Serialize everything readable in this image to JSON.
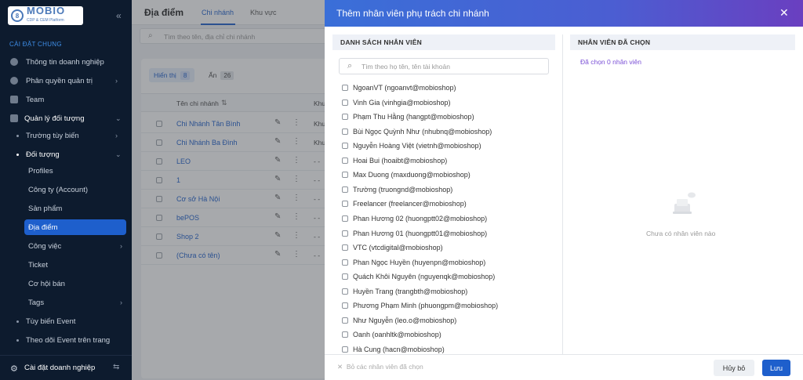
{
  "sidebar": {
    "logo": {
      "text": "MOBIO",
      "sub": "CDP & CEM Platform"
    },
    "section_label": "CÀI ĐẶT CHUNG",
    "items": [
      {
        "label": "Thông tin doanh nghiệp",
        "icon": "building-icon"
      },
      {
        "label": "Phân quyền quản trị",
        "icon": "user-shield-icon"
      },
      {
        "label": "Team",
        "icon": "team-icon"
      },
      {
        "label": "Quản lý đối tượng",
        "icon": "database-icon"
      },
      {
        "label": "Trường tùy biến"
      },
      {
        "label": "Đối tượng"
      },
      {
        "label": "Profiles"
      },
      {
        "label": "Công ty (Account)"
      },
      {
        "label": "Sản phẩm"
      },
      {
        "label": "Địa điểm"
      },
      {
        "label": "Công việc"
      },
      {
        "label": "Ticket"
      },
      {
        "label": "Cơ hội bán"
      },
      {
        "label": "Tags"
      },
      {
        "label": "Tùy biến Event"
      },
      {
        "label": "Theo dõi Event trên trang"
      }
    ],
    "bottom_label": "Cài đặt doanh nghiệp"
  },
  "main": {
    "title": "Địa điểm",
    "tabs": [
      "Chi nhánh",
      "Khu vực"
    ],
    "search_placeholder": "Tìm theo tên, địa chỉ chi nhánh",
    "pills": [
      {
        "label": "Hiển thị",
        "count": "8"
      },
      {
        "label": "Ẩn",
        "count": "26"
      }
    ],
    "col_name": "Tên chi nhánh",
    "col_kv": "Khu",
    "rows": [
      {
        "name": "Chi Nhánh Tân Bình",
        "kv": "Khu"
      },
      {
        "name": "Chi Nhánh Ba Đình",
        "kv": "Khu"
      },
      {
        "name": "LEO",
        "kv": "- -"
      },
      {
        "name": "1",
        "kv": "- -"
      },
      {
        "name": "Cơ sở Hà Nội",
        "kv": "- -"
      },
      {
        "name": "bePOS",
        "kv": "- -"
      },
      {
        "name": "Shop 2",
        "kv": "- -"
      },
      {
        "name": "(Chưa có tên)",
        "kv": "- -"
      }
    ]
  },
  "modal": {
    "title": "Thêm nhân viên phụ trách chi nhánh",
    "left_header": "DANH SÁCH NHÂN VIÊN",
    "right_header": "NHÂN VIÊN ĐÃ CHỌN",
    "search_placeholder": "Tìm theo họ tên, tên tài khoản",
    "selected_count": "Đã chọn 0 nhân viên",
    "empty_text": "Chưa có nhân viên nào",
    "employees": [
      "NgoanVT (ngoanvt@mobioshop)",
      "Vinh Gia (vinhgia@mobioshop)",
      "Phạm Thu Hằng (hangpt@mobioshop)",
      "Bùi Ngọc Quỳnh Như (nhubnq@mobioshop)",
      "Nguyễn Hoàng Việt (vietnh@mobioshop)",
      "Hoai Bui (hoaibt@mobioshop)",
      "Max Duong (maxduong@mobioshop)",
      "Trường (truongnd@mobioshop)",
      "Freelancer (freelancer@mobioshop)",
      "Phan Hương 02 (huongptt02@mobioshop)",
      "Phan Hương 01 (huongptt01@mobioshop)",
      "VTC (vtcdigital@mobioshop)",
      "Phan Ngọc Huyền (huyenpn@mobioshop)",
      "Quách Khôi Nguyên (nguyenqk@mobioshop)",
      "Huyền Trang (trangbth@mobioshop)",
      "Phương Phạm Minh (phuongpm@mobioshop)",
      "Như Nguyễn (leo.o@mobioshop)",
      "Oanh (oanhltk@mobioshop)",
      "Hà Cung (hacn@mobioshop)"
    ],
    "clear_label": "Bỏ các nhân viên đã chọn",
    "cancel_label": "Hủy bỏ",
    "save_label": "Lưu"
  }
}
